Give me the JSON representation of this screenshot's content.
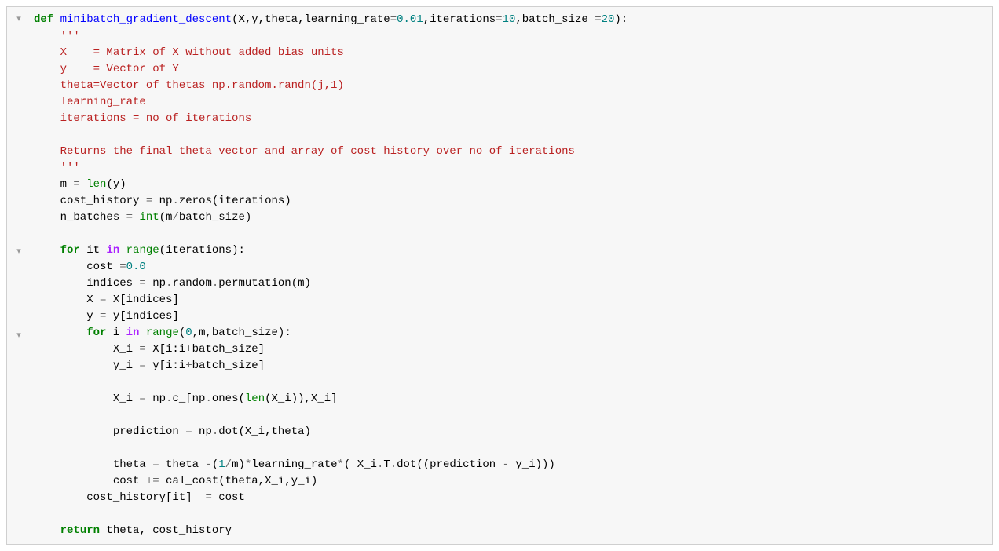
{
  "fold_markers": [
    "▾",
    "▾",
    "▾"
  ],
  "code": {
    "tokens": [
      [
        {
          "c": "k",
          "t": "def"
        },
        {
          "c": "n",
          "t": " "
        },
        {
          "c": "nf",
          "t": "minibatch_gradient_descent"
        },
        {
          "c": "p",
          "t": "(X,y,theta,learning_rate"
        },
        {
          "c": "op",
          "t": "="
        },
        {
          "c": "m",
          "t": "0.01"
        },
        {
          "c": "p",
          "t": ",iterations"
        },
        {
          "c": "op",
          "t": "="
        },
        {
          "c": "m",
          "t": "10"
        },
        {
          "c": "p",
          "t": ",batch_size "
        },
        {
          "c": "op",
          "t": "="
        },
        {
          "c": "m",
          "t": "20"
        },
        {
          "c": "p",
          "t": "):"
        }
      ],
      [
        {
          "c": "s",
          "t": "    '''"
        }
      ],
      [
        {
          "c": "s",
          "t": "    X    = Matrix of X without added bias units"
        }
      ],
      [
        {
          "c": "s",
          "t": "    y    = Vector of Y"
        }
      ],
      [
        {
          "c": "s",
          "t": "    theta=Vector of thetas np.random.randn(j,1)"
        }
      ],
      [
        {
          "c": "s",
          "t": "    learning_rate "
        }
      ],
      [
        {
          "c": "s",
          "t": "    iterations = no of iterations"
        }
      ],
      [
        {
          "c": "s",
          "t": "    "
        }
      ],
      [
        {
          "c": "s",
          "t": "    Returns the final theta vector and array of cost history over no of iterations"
        }
      ],
      [
        {
          "c": "s",
          "t": "    '''"
        }
      ],
      [
        {
          "c": "p",
          "t": "    m "
        },
        {
          "c": "op",
          "t": "="
        },
        {
          "c": "p",
          "t": " "
        },
        {
          "c": "nb",
          "t": "len"
        },
        {
          "c": "p",
          "t": "(y)"
        }
      ],
      [
        {
          "c": "p",
          "t": "    cost_history "
        },
        {
          "c": "op",
          "t": "="
        },
        {
          "c": "p",
          "t": " np"
        },
        {
          "c": "op",
          "t": "."
        },
        {
          "c": "p",
          "t": "zeros(iterations)"
        }
      ],
      [
        {
          "c": "p",
          "t": "    n_batches "
        },
        {
          "c": "op",
          "t": "="
        },
        {
          "c": "p",
          "t": " "
        },
        {
          "c": "nb",
          "t": "int"
        },
        {
          "c": "p",
          "t": "(m"
        },
        {
          "c": "op",
          "t": "/"
        },
        {
          "c": "p",
          "t": "batch_size)"
        }
      ],
      [
        {
          "c": "p",
          "t": "    "
        }
      ],
      [
        {
          "c": "p",
          "t": "    "
        },
        {
          "c": "k",
          "t": "for"
        },
        {
          "c": "p",
          "t": " it "
        },
        {
          "c": "o",
          "t": "in"
        },
        {
          "c": "p",
          "t": " "
        },
        {
          "c": "nb",
          "t": "range"
        },
        {
          "c": "p",
          "t": "(iterations):"
        }
      ],
      [
        {
          "c": "p",
          "t": "        cost "
        },
        {
          "c": "op",
          "t": "="
        },
        {
          "c": "m",
          "t": "0.0"
        }
      ],
      [
        {
          "c": "p",
          "t": "        indices "
        },
        {
          "c": "op",
          "t": "="
        },
        {
          "c": "p",
          "t": " np"
        },
        {
          "c": "op",
          "t": "."
        },
        {
          "c": "p",
          "t": "random"
        },
        {
          "c": "op",
          "t": "."
        },
        {
          "c": "p",
          "t": "permutation(m)"
        }
      ],
      [
        {
          "c": "p",
          "t": "        X "
        },
        {
          "c": "op",
          "t": "="
        },
        {
          "c": "p",
          "t": " X[indices]"
        }
      ],
      [
        {
          "c": "p",
          "t": "        y "
        },
        {
          "c": "op",
          "t": "="
        },
        {
          "c": "p",
          "t": " y[indices]"
        }
      ],
      [
        {
          "c": "p",
          "t": "        "
        },
        {
          "c": "k",
          "t": "for"
        },
        {
          "c": "p",
          "t": " i "
        },
        {
          "c": "o",
          "t": "in"
        },
        {
          "c": "p",
          "t": " "
        },
        {
          "c": "nb",
          "t": "range"
        },
        {
          "c": "p",
          "t": "("
        },
        {
          "c": "m",
          "t": "0"
        },
        {
          "c": "p",
          "t": ",m,batch_size):"
        }
      ],
      [
        {
          "c": "p",
          "t": "            X_i "
        },
        {
          "c": "op",
          "t": "="
        },
        {
          "c": "p",
          "t": " X[i:i"
        },
        {
          "c": "op",
          "t": "+"
        },
        {
          "c": "p",
          "t": "batch_size]"
        }
      ],
      [
        {
          "c": "p",
          "t": "            y_i "
        },
        {
          "c": "op",
          "t": "="
        },
        {
          "c": "p",
          "t": " y[i:i"
        },
        {
          "c": "op",
          "t": "+"
        },
        {
          "c": "p",
          "t": "batch_size]"
        }
      ],
      [
        {
          "c": "p",
          "t": "            "
        }
      ],
      [
        {
          "c": "p",
          "t": "            X_i "
        },
        {
          "c": "op",
          "t": "="
        },
        {
          "c": "p",
          "t": " np"
        },
        {
          "c": "op",
          "t": "."
        },
        {
          "c": "p",
          "t": "c_[np"
        },
        {
          "c": "op",
          "t": "."
        },
        {
          "c": "p",
          "t": "ones("
        },
        {
          "c": "nb",
          "t": "len"
        },
        {
          "c": "p",
          "t": "(X_i)),X_i]"
        }
      ],
      [
        {
          "c": "p",
          "t": "            "
        }
      ],
      [
        {
          "c": "p",
          "t": "            prediction "
        },
        {
          "c": "op",
          "t": "="
        },
        {
          "c": "p",
          "t": " np"
        },
        {
          "c": "op",
          "t": "."
        },
        {
          "c": "p",
          "t": "dot(X_i,theta)"
        }
      ],
      [
        {
          "c": "p",
          "t": ""
        }
      ],
      [
        {
          "c": "p",
          "t": "            theta "
        },
        {
          "c": "op",
          "t": "="
        },
        {
          "c": "p",
          "t": " theta "
        },
        {
          "c": "op",
          "t": "-"
        },
        {
          "c": "p",
          "t": "("
        },
        {
          "c": "m",
          "t": "1"
        },
        {
          "c": "op",
          "t": "/"
        },
        {
          "c": "p",
          "t": "m)"
        },
        {
          "c": "op",
          "t": "*"
        },
        {
          "c": "p",
          "t": "learning_rate"
        },
        {
          "c": "op",
          "t": "*"
        },
        {
          "c": "p",
          "t": "( X_i"
        },
        {
          "c": "op",
          "t": "."
        },
        {
          "c": "p",
          "t": "T"
        },
        {
          "c": "op",
          "t": "."
        },
        {
          "c": "p",
          "t": "dot((prediction "
        },
        {
          "c": "op",
          "t": "-"
        },
        {
          "c": "p",
          "t": " y_i)))"
        }
      ],
      [
        {
          "c": "p",
          "t": "            cost "
        },
        {
          "c": "op",
          "t": "+="
        },
        {
          "c": "p",
          "t": " cal_cost(theta,X_i,y_i)"
        }
      ],
      [
        {
          "c": "p",
          "t": "        cost_history[it]  "
        },
        {
          "c": "op",
          "t": "="
        },
        {
          "c": "p",
          "t": " cost"
        }
      ],
      [
        {
          "c": "p",
          "t": "        "
        }
      ],
      [
        {
          "c": "p",
          "t": "    "
        },
        {
          "c": "k",
          "t": "return"
        },
        {
          "c": "p",
          "t": " theta, cost_history"
        }
      ]
    ]
  }
}
